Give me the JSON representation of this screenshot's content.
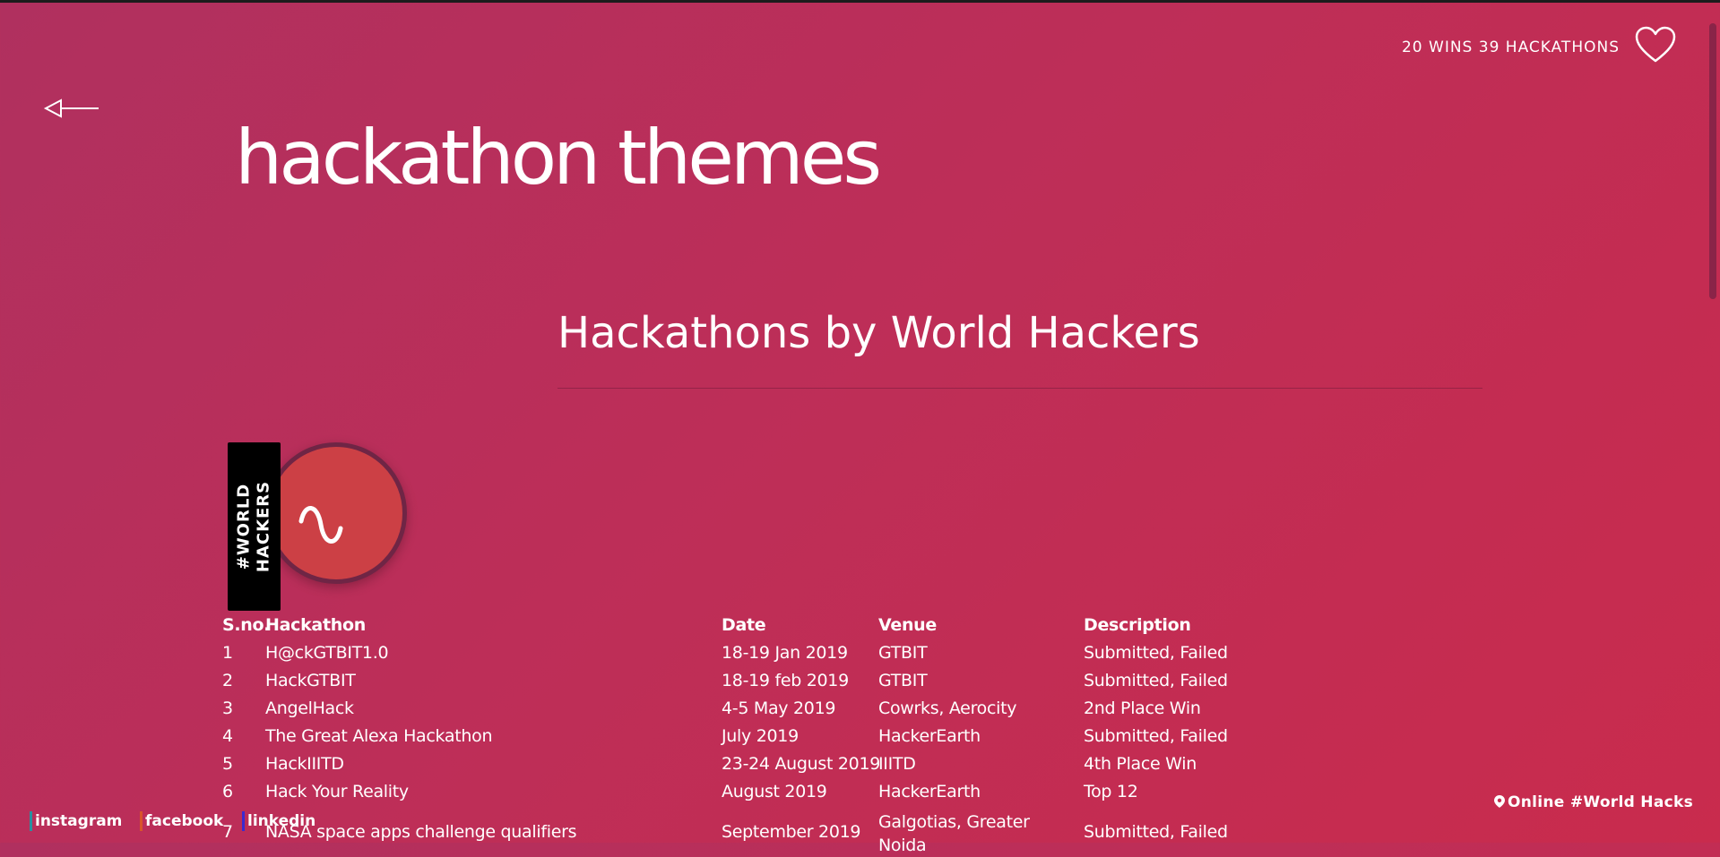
{
  "header": {
    "stats": "20 WINS 39 HACKATHONS"
  },
  "page_title": "hackathon themes",
  "section_title": "Hackathons by World Hackers",
  "badge": {
    "label": "#WORLD\nHACKERS"
  },
  "table": {
    "headers": [
      "S.no.",
      "Hackathon",
      "Date",
      "Venue",
      "Description"
    ],
    "rows": [
      [
        "1",
        "H@ckGTBIT1.0",
        "18-19 Jan 2019",
        "GTBIT",
        "Submitted, Failed"
      ],
      [
        "2",
        "HackGTBIT",
        "18-19 feb 2019",
        "GTBIT",
        "Submitted, Failed"
      ],
      [
        "3",
        "AngelHack",
        "4-5 May 2019",
        "Cowrks, Aerocity",
        "2nd Place Win"
      ],
      [
        "4",
        "The Great Alexa Hackathon",
        "July 2019",
        "HackerEarth",
        "Submitted, Failed"
      ],
      [
        "5",
        "HackIIITD",
        "23-24 August 2019",
        "IIITD",
        "4th Place Win"
      ],
      [
        "6",
        "Hack Your Reality",
        "August 2019",
        "HackerEarth",
        "Top 12"
      ],
      [
        "7",
        "NASA space apps challenge qualifiers",
        "September 2019",
        "Galgotias, Greater Noida",
        "Submitted, Failed"
      ]
    ]
  },
  "social": [
    {
      "label": "instagram",
      "color": "#2a8fa0"
    },
    {
      "label": "facebook",
      "color": "#d8542c"
    },
    {
      "label": "linkedin",
      "color": "#3b2ad0"
    }
  ],
  "footer": {
    "location": "Online #World Hacks"
  },
  "colors": {
    "background_start": "#b0305f",
    "background_end": "#c92b4d",
    "badge_circle": "#cc4045",
    "badge_ring": "#6f2545"
  }
}
